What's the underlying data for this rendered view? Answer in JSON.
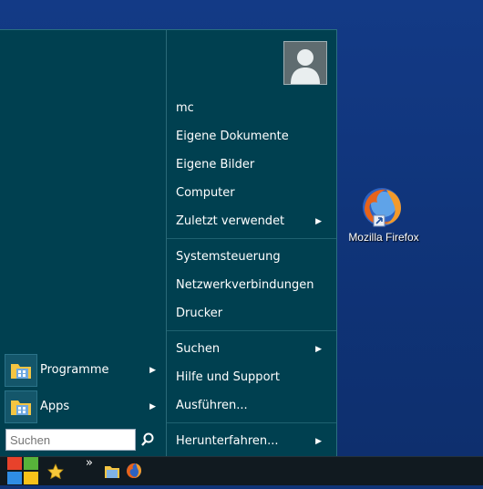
{
  "desktop": {
    "icons": [
      {
        "label": "Mozilla Firefox",
        "icon": "firefox-icon"
      }
    ]
  },
  "start_menu": {
    "user_picture": "user-avatar-icon",
    "right_items": [
      {
        "label": "mc",
        "submenu": false
      },
      {
        "label": "Eigene Dokumente",
        "submenu": false
      },
      {
        "label": "Eigene Bilder",
        "submenu": false
      },
      {
        "label": "Computer",
        "submenu": false
      },
      {
        "label": "Zuletzt verwendet",
        "submenu": true
      },
      {
        "label": "Systemsteuerung",
        "submenu": false
      },
      {
        "label": "Netzwerkverbindungen",
        "submenu": false
      },
      {
        "label": "Drucker",
        "submenu": false
      },
      {
        "label": "Suchen",
        "submenu": true
      },
      {
        "label": "Hilfe und Support",
        "submenu": false
      },
      {
        "label": "Ausführen...",
        "submenu": false
      },
      {
        "label": "Herunterfahren...",
        "submenu": true
      }
    ],
    "left_items": [
      {
        "label": "Programme",
        "icon": "folder-icon",
        "submenu": true
      },
      {
        "label": "Apps",
        "icon": "folder-icon",
        "submenu": true
      }
    ],
    "search": {
      "placeholder": "Suchen"
    }
  },
  "taskbar": {
    "start_icon": "windows-logo-icon",
    "items": [
      "favorites-star-icon",
      "overflow-chevron-icon",
      "file-explorer-icon",
      "firefox-icon"
    ],
    "overflow_glyph": "»"
  },
  "colors": {
    "desktop": "#0f3478",
    "menu": "#004050",
    "taskbar": "#111a20"
  }
}
